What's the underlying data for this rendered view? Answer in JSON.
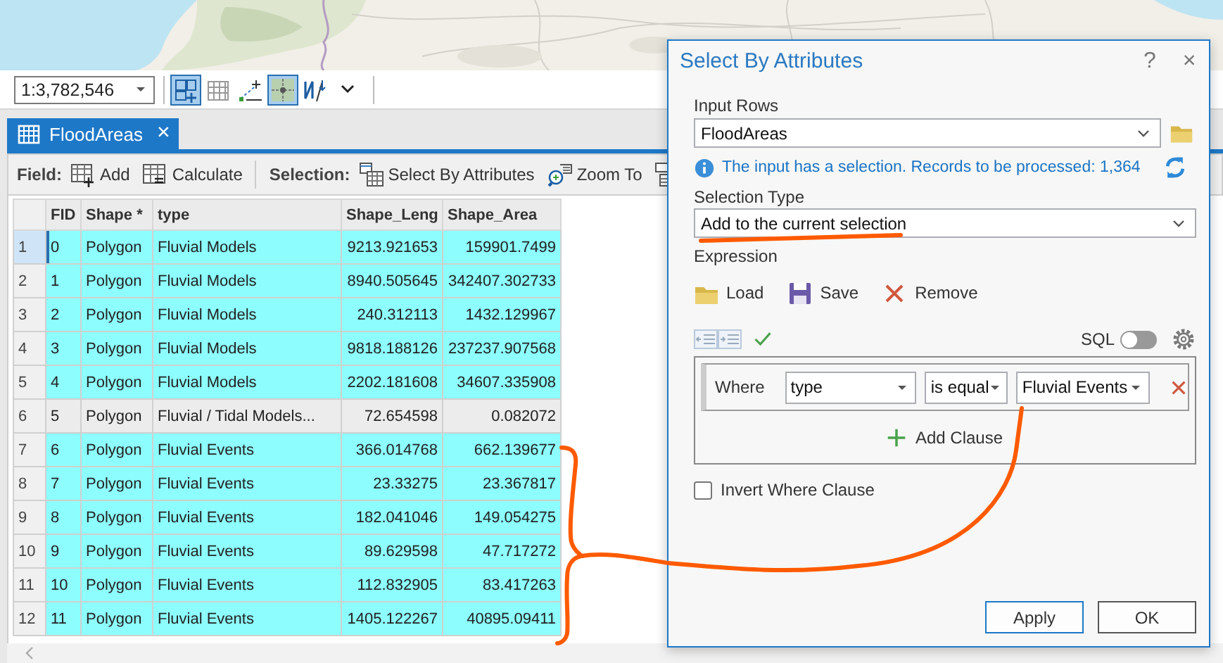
{
  "map_toolbar": {
    "scale": "1:3,782,546",
    "tools": [
      {
        "kind": "grid-add",
        "selected": true
      },
      {
        "kind": "grid",
        "selected": false
      },
      {
        "kind": "snap",
        "selected": false
      },
      {
        "kind": "crosshair",
        "selected": true
      },
      {
        "kind": "north",
        "selected": false
      },
      {
        "kind": "more",
        "selected": false
      }
    ]
  },
  "table_view": {
    "tab": {
      "label": "FloodAreas",
      "close": "×",
      "selected": true
    },
    "toolbar": {
      "field_label": "Field:",
      "field_buttons": [
        {
          "kind": "add",
          "label": "Add"
        },
        {
          "kind": "calculate",
          "label": "Calculate"
        }
      ],
      "selection_label": "Selection:",
      "selection_buttons": [
        {
          "kind": "select",
          "label": "Select By Attributes"
        },
        {
          "kind": "zoom",
          "label": "Zoom To"
        },
        {
          "kind": "switch"
        }
      ]
    },
    "columns": [
      "FID",
      "Shape *",
      "type",
      "Shape_Leng",
      "Shape_Area"
    ],
    "rows": [
      {
        "number": "1",
        "current": true,
        "selected": true,
        "cells": [
          "0",
          "Polygon",
          "Fluvial Models",
          "9213.921653",
          "159901.7499"
        ]
      },
      {
        "number": "2",
        "current": false,
        "selected": true,
        "cells": [
          "1",
          "Polygon",
          "Fluvial Models",
          "8940.505645",
          "342407.302733"
        ]
      },
      {
        "number": "3",
        "current": false,
        "selected": true,
        "cells": [
          "2",
          "Polygon",
          "Fluvial Models",
          "240.312113",
          "1432.129967"
        ]
      },
      {
        "number": "4",
        "current": false,
        "selected": true,
        "cells": [
          "3",
          "Polygon",
          "Fluvial Models",
          "9818.188126",
          "237237.907568"
        ]
      },
      {
        "number": "5",
        "current": false,
        "selected": true,
        "cells": [
          "4",
          "Polygon",
          "Fluvial Models",
          "2202.181608",
          "34607.335908"
        ]
      },
      {
        "number": "6",
        "current": false,
        "selected": false,
        "cells": [
          "5",
          "Polygon",
          "Fluvial / Tidal Models...",
          "72.654598",
          "0.082072"
        ]
      },
      {
        "number": "7",
        "current": false,
        "selected": true,
        "cells": [
          "6",
          "Polygon",
          "Fluvial Events",
          "366.014768",
          "662.139677"
        ]
      },
      {
        "number": "8",
        "current": false,
        "selected": true,
        "cells": [
          "7",
          "Polygon",
          "Fluvial Events",
          "23.33275",
          "23.367817"
        ]
      },
      {
        "number": "9",
        "current": false,
        "selected": true,
        "cells": [
          "8",
          "Polygon",
          "Fluvial Events",
          "182.041046",
          "149.054275"
        ]
      },
      {
        "number": "10",
        "current": false,
        "selected": true,
        "cells": [
          "9",
          "Polygon",
          "Fluvial Events",
          "89.629598",
          "47.717272"
        ]
      },
      {
        "number": "11",
        "current": false,
        "selected": true,
        "cells": [
          "10",
          "Polygon",
          "Fluvial Events",
          "112.832905",
          "83.417263"
        ]
      },
      {
        "number": "12",
        "current": false,
        "selected": true,
        "cells": [
          "11",
          "Polygon",
          "Fluvial Events",
          "1405.122267",
          "40895.09411"
        ]
      }
    ]
  },
  "dialog": {
    "title": "Select By Attributes",
    "help": "?",
    "close": "×",
    "input_rows": {
      "label": "Input Rows",
      "value": "FloodAreas"
    },
    "info": "The input has a selection. Records to be processed: 1,364",
    "selection_type": {
      "label": "Selection Type",
      "value": "Add to the current selection"
    },
    "expression": {
      "label": "Expression",
      "actions": [
        {
          "kind": "load",
          "label": "Load"
        },
        {
          "kind": "save",
          "label": "Save"
        },
        {
          "kind": "remove",
          "label": "Remove"
        }
      ],
      "sql": {
        "label": "SQL",
        "on": false
      },
      "clauses": [
        {
          "keyword": "Where",
          "field": "type",
          "operator": "is equal",
          "value": "Fluvial Events"
        }
      ],
      "add_clause": "Add Clause"
    },
    "invert": {
      "label": "Invert Where Clause",
      "checked": false
    },
    "buttons": [
      {
        "label": "Apply",
        "focused": true
      },
      {
        "label": "OK",
        "focused": false
      }
    ]
  }
}
